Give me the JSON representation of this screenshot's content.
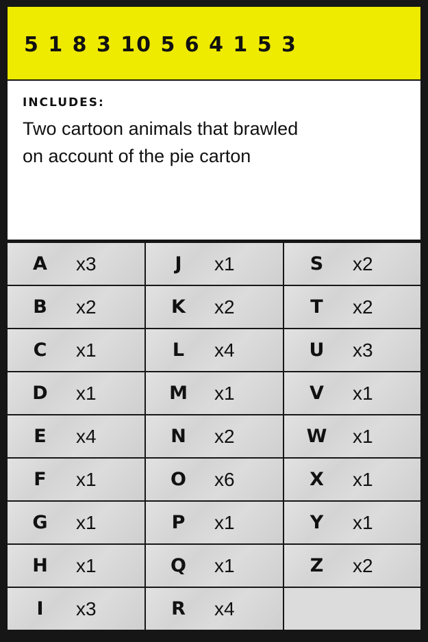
{
  "header": {
    "number": "5 1 8 3 10 5 6 4 1 5 3"
  },
  "includes": {
    "title": "INCLUDES:",
    "line1": "Two cartoon animals that brawled",
    "line2": "on account of the pie carton"
  },
  "columns": [
    [
      {
        "letter": "A",
        "count": "x3"
      },
      {
        "letter": "B",
        "count": "x2"
      },
      {
        "letter": "C",
        "count": "x1"
      },
      {
        "letter": "D",
        "count": "x1"
      },
      {
        "letter": "E",
        "count": "x4"
      },
      {
        "letter": "F",
        "count": "x1"
      },
      {
        "letter": "G",
        "count": "x1"
      },
      {
        "letter": "H",
        "count": "x1"
      },
      {
        "letter": "I",
        "count": "x3"
      }
    ],
    [
      {
        "letter": "J",
        "count": "x1"
      },
      {
        "letter": "K",
        "count": "x2"
      },
      {
        "letter": "L",
        "count": "x4"
      },
      {
        "letter": "M",
        "count": "x1"
      },
      {
        "letter": "N",
        "count": "x2"
      },
      {
        "letter": "O",
        "count": "x6"
      },
      {
        "letter": "P",
        "count": "x1"
      },
      {
        "letter": "Q",
        "count": "x1"
      },
      {
        "letter": "R",
        "count": "x4"
      }
    ],
    [
      {
        "letter": "S",
        "count": "x2"
      },
      {
        "letter": "T",
        "count": "x2"
      },
      {
        "letter": "U",
        "count": "x3"
      },
      {
        "letter": "V",
        "count": "x1"
      },
      {
        "letter": "W",
        "count": "x1"
      },
      {
        "letter": "X",
        "count": "x1"
      },
      {
        "letter": "Y",
        "count": "x1"
      },
      {
        "letter": "Z",
        "count": "x2"
      }
    ]
  ],
  "colors": {
    "header": "#eeea00",
    "border": "#161616",
    "cell": "#dcdcdc"
  }
}
